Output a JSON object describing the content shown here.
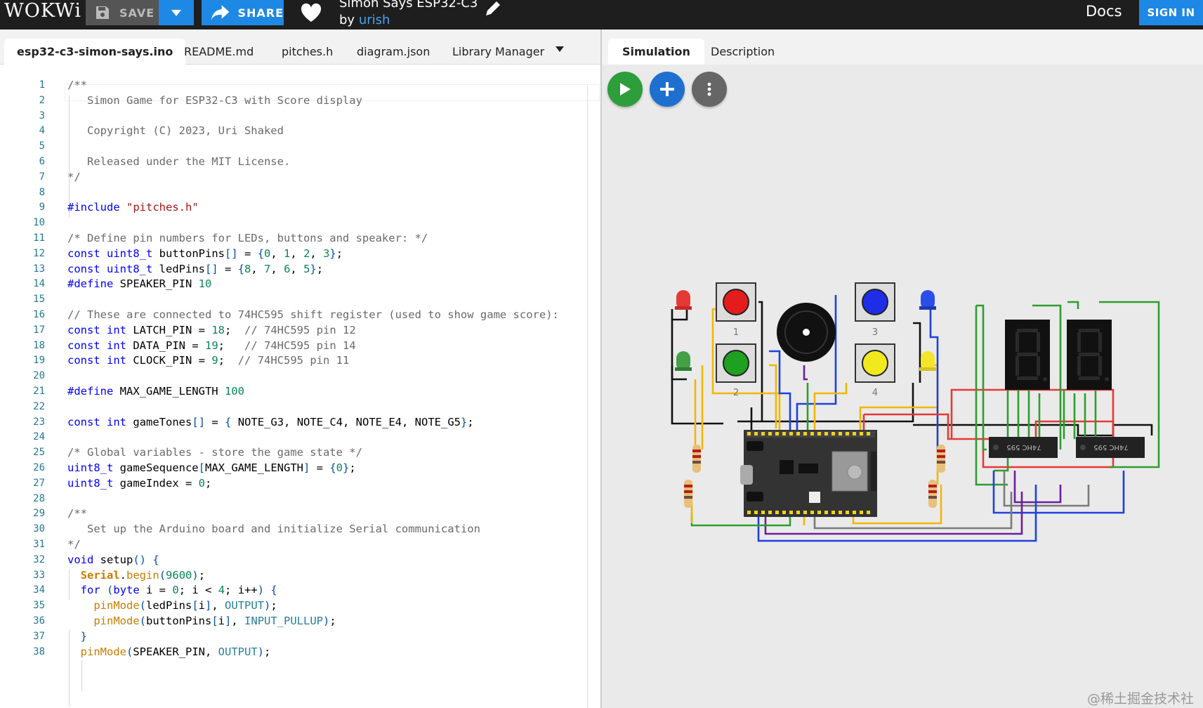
{
  "header": {
    "logo": "WOKWi",
    "save_label": "SAVE",
    "share_label": "SHARE",
    "project_title": "Simon Says ESP32-C3",
    "by_label": "by",
    "author": "urish",
    "docs_label": "Docs",
    "signin_label": "SIGN IN",
    "icons": [
      "save-icon",
      "chevron-down-icon",
      "share-arrow-icon",
      "heart-icon",
      "pencil-icon"
    ]
  },
  "editor": {
    "tabs": [
      {
        "label": "esp32-c3-simon-says.ino",
        "active": true
      },
      {
        "label": "README.md",
        "active": false
      },
      {
        "label": "pitches.h",
        "active": false
      },
      {
        "label": "diagram.json",
        "active": false
      },
      {
        "label": "Library Manager",
        "active": false
      }
    ],
    "lines": [
      "/**",
      "   Simon Game for ESP32-C3 with Score display",
      "",
      "   Copyright (C) 2023, Uri Shaked",
      "",
      "   Released under the MIT License.",
      "*/",
      "",
      "#include \"pitches.h\"",
      "",
      "/* Define pin numbers for LEDs, buttons and speaker: */",
      "const uint8_t buttonPins[] = {0, 1, 2, 3};",
      "const uint8_t ledPins[] = {8, 7, 6, 5};",
      "#define SPEAKER_PIN 10",
      "",
      "// These are connected to 74HC595 shift register (used to show game score):",
      "const int LATCH_PIN = 18;  // 74HC595 pin 12",
      "const int DATA_PIN = 19;   // 74HC595 pin 14",
      "const int CLOCK_PIN = 9;  // 74HC595 pin 11",
      "",
      "#define MAX_GAME_LENGTH 100",
      "",
      "const int gameTones[] = { NOTE_G3, NOTE_C4, NOTE_E4, NOTE_G5};",
      "",
      "/* Global variables - store the game state */",
      "uint8_t gameSequence[MAX_GAME_LENGTH] = {0};",
      "uint8_t gameIndex = 0;",
      "",
      "/**",
      "   Set up the Arduino board and initialize Serial communication",
      "*/",
      "void setup() {",
      "  Serial.begin(9600);",
      "  for (byte i = 0; i < 4; i++) {",
      "    pinMode(ledPins[i], OUTPUT);",
      "    pinMode(buttonPins[i], INPUT_PULLUP);",
      "  }",
      "  pinMode(SPEAKER_PIN, OUTPUT);"
    ]
  },
  "simulation": {
    "tabs": [
      {
        "label": "Simulation",
        "active": true
      },
      {
        "label": "Description",
        "active": false
      }
    ],
    "controls": [
      "play-icon",
      "plus-icon",
      "more-vertical-icon"
    ],
    "button_labels": [
      "1",
      "2",
      "3",
      "4"
    ],
    "shift_register_label": "74HC 595",
    "board_label": "ESP32-C3",
    "colors": {
      "red": "#e53935",
      "green": "#2e9d2e",
      "blue": "#1e40e0",
      "yellow": "#f5e52a",
      "wire_black": "#111111",
      "wire_yellow": "#f2b705"
    }
  },
  "watermark": "@稀土掘金技术社区"
}
